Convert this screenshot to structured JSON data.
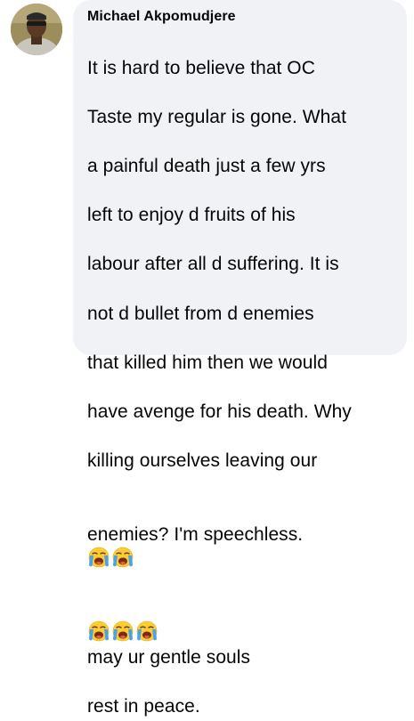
{
  "comment": {
    "author_name": "Michael Akpomudjere",
    "text_lines": [
      "It is hard to believe that OC",
      "Taste my regular is gone. What",
      "a painful death just a few yrs",
      "left to enjoy d fruits of his",
      "labour after all d suffering. It is",
      "not d bullet from d enemies",
      "that killed him then we would",
      "have avenge for his death. Why",
      "killing ourselves leaving our",
      "enemies? I'm speechless."
    ],
    "line_11_text": "may ur gentle souls",
    "line_12_text": "rest in peace.",
    "emoji_name": "loudly-crying-face",
    "bubble_color": "#f0f2f5",
    "text_color": "#050505"
  }
}
